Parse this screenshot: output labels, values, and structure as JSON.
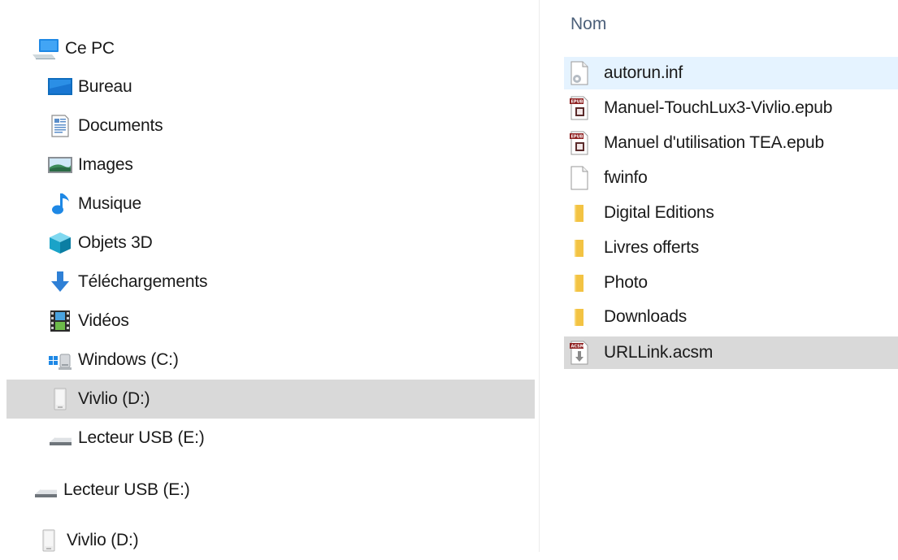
{
  "nav": {
    "items": [
      {
        "label": "Ce PC",
        "icon": "computer-icon"
      },
      {
        "label": "Bureau",
        "icon": "desktop-icon"
      },
      {
        "label": "Documents",
        "icon": "documents-icon"
      },
      {
        "label": "Images",
        "icon": "pictures-icon"
      },
      {
        "label": "Musique",
        "icon": "music-icon"
      },
      {
        "label": "Objets 3D",
        "icon": "3d-objects-icon"
      },
      {
        "label": "Téléchargements",
        "icon": "downloads-icon"
      },
      {
        "label": "Vidéos",
        "icon": "videos-icon"
      },
      {
        "label": "Windows (C:)",
        "icon": "windows-drive-icon"
      },
      {
        "label": "Vivlio (D:)",
        "icon": "ereader-drive-icon",
        "selected": true
      },
      {
        "label": "Lecteur USB (E:)",
        "icon": "usb-drive-icon"
      },
      {
        "label": "Lecteur USB (E:)",
        "icon": "usb-drive-icon"
      },
      {
        "label": "Vivlio (D:)",
        "icon": "ereader-drive-icon"
      }
    ]
  },
  "files": {
    "column_header": "Nom",
    "rows": [
      {
        "name": "autorun.inf",
        "icon": "settings-file-icon",
        "state": "hover"
      },
      {
        "name": "Manuel-TouchLux3-Vivlio.epub",
        "icon": "epub-file-icon"
      },
      {
        "name": "Manuel d'utilisation TEA.epub",
        "icon": "epub-file-icon"
      },
      {
        "name": "fwinfo",
        "icon": "blank-file-icon"
      },
      {
        "name": "Digital Editions",
        "icon": "folder-icon"
      },
      {
        "name": "Livres offerts",
        "icon": "folder-icon"
      },
      {
        "name": "Photo",
        "icon": "folder-icon"
      },
      {
        "name": "Downloads",
        "icon": "folder-icon"
      },
      {
        "name": "URLLink.acsm",
        "icon": "acsm-file-icon",
        "state": "selected"
      }
    ]
  },
  "colors": {
    "selection": "#d9d9d9",
    "hover": "#e5f3ff",
    "header_text": "#4c607a",
    "folder": "#f8d775"
  },
  "icon_text": {
    "epub_tag": "EPUB",
    "acsm_tag": "ACSM"
  }
}
